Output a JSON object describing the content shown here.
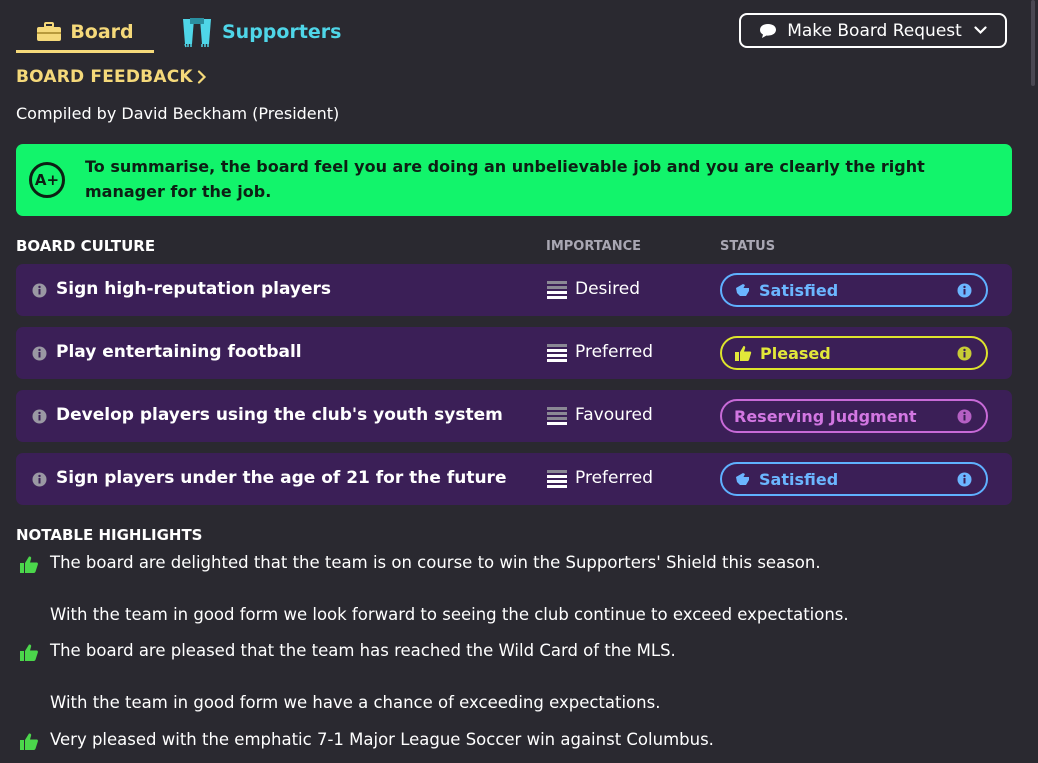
{
  "tabs": [
    {
      "label": "Board",
      "icon": "briefcase-icon",
      "active": true
    },
    {
      "label": "Supporters",
      "icon": "scarf-icon",
      "active": false
    }
  ],
  "request_button": {
    "label": "Make Board Request",
    "icon": "speech-bubble-icon"
  },
  "feedback": {
    "title": "BOARD FEEDBACK",
    "compiled_by": "Compiled by David Beckham (President)",
    "grade": "A+",
    "summary": "To summarise, the board feel you are doing an unbelievable job and you are clearly the right manager for the job."
  },
  "culture": {
    "header": "BOARD CULTURE",
    "importance_header": "IMPORTANCE",
    "status_header": "STATUS",
    "rows": [
      {
        "label": "Sign high-reputation players",
        "importance": "Desired",
        "status": "Satisfied",
        "status_color": "#5fb1ff",
        "status_icon": "thumb-tilt-icon"
      },
      {
        "label": "Play entertaining football",
        "importance": "Preferred",
        "status": "Pleased",
        "status_color": "#dde42c",
        "status_icon": "thumbs-up-icon"
      },
      {
        "label": "Develop players using the club's youth system",
        "importance": "Favoured",
        "status": "Reserving Judgment",
        "status_color": "#c86ad8",
        "status_icon": ""
      },
      {
        "label": "Sign players under the age of 21 for the future",
        "importance": "Preferred",
        "status": "Satisfied",
        "status_color": "#5fb1ff",
        "status_icon": "thumb-tilt-icon"
      }
    ]
  },
  "highlights": {
    "title": "NOTABLE HIGHLIGHTS",
    "items": [
      {
        "text": "The board are delighted that the team is on course to win the Supporters' Shield this season.",
        "note": "With the team in good form we look forward to seeing the club continue to exceed expectations."
      },
      {
        "text": "The board are pleased that the team has reached the Wild Card of the MLS.",
        "note": "With the team in good form we have a chance of exceeding expectations."
      },
      {
        "text": "Very pleased with the emphatic 7-1 Major League Soccer win against Columbus.",
        "note": ""
      }
    ]
  },
  "colors": {
    "accent": "#f5d97a",
    "supporters": "#4fd6e8",
    "summary_bg": "#12f46b",
    "row_bg": "#3b1f57",
    "thumb_green": "#4bd64b"
  }
}
